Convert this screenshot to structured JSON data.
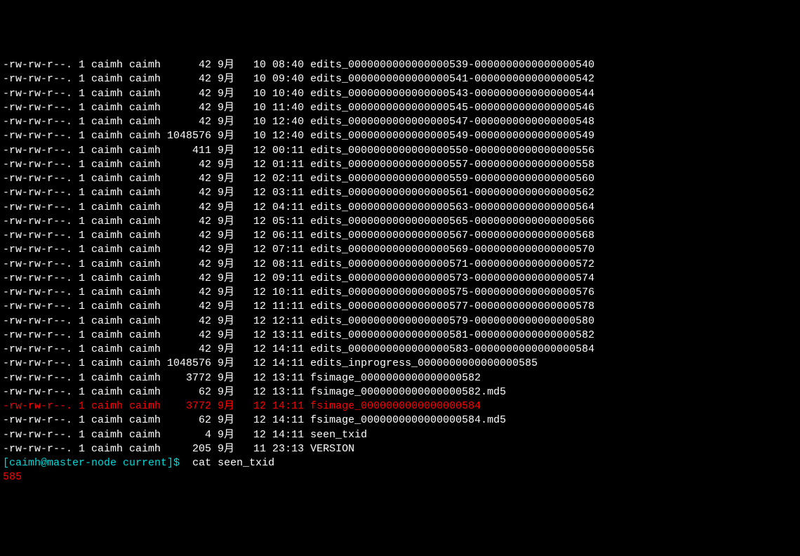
{
  "terminal": {
    "listing": [
      {
        "perms": "-rw-rw-r--.",
        "links": "1",
        "owner": "caimh",
        "group": "caimh",
        "size": "42",
        "month": "9月",
        "day": "10",
        "time": "08:40",
        "name": "edits_0000000000000000539-0000000000000000540",
        "highlight": false
      },
      {
        "perms": "-rw-rw-r--.",
        "links": "1",
        "owner": "caimh",
        "group": "caimh",
        "size": "42",
        "month": "9月",
        "day": "10",
        "time": "09:40",
        "name": "edits_0000000000000000541-0000000000000000542",
        "highlight": false
      },
      {
        "perms": "-rw-rw-r--.",
        "links": "1",
        "owner": "caimh",
        "group": "caimh",
        "size": "42",
        "month": "9月",
        "day": "10",
        "time": "10:40",
        "name": "edits_0000000000000000543-0000000000000000544",
        "highlight": false
      },
      {
        "perms": "-rw-rw-r--.",
        "links": "1",
        "owner": "caimh",
        "group": "caimh",
        "size": "42",
        "month": "9月",
        "day": "10",
        "time": "11:40",
        "name": "edits_0000000000000000545-0000000000000000546",
        "highlight": false
      },
      {
        "perms": "-rw-rw-r--.",
        "links": "1",
        "owner": "caimh",
        "group": "caimh",
        "size": "42",
        "month": "9月",
        "day": "10",
        "time": "12:40",
        "name": "edits_0000000000000000547-0000000000000000548",
        "highlight": false
      },
      {
        "perms": "-rw-rw-r--.",
        "links": "1",
        "owner": "caimh",
        "group": "caimh",
        "size": "1048576",
        "month": "9月",
        "day": "10",
        "time": "12:40",
        "name": "edits_0000000000000000549-0000000000000000549",
        "highlight": false
      },
      {
        "perms": "-rw-rw-r--.",
        "links": "1",
        "owner": "caimh",
        "group": "caimh",
        "size": "411",
        "month": "9月",
        "day": "12",
        "time": "00:11",
        "name": "edits_0000000000000000550-0000000000000000556",
        "highlight": false
      },
      {
        "perms": "-rw-rw-r--.",
        "links": "1",
        "owner": "caimh",
        "group": "caimh",
        "size": "42",
        "month": "9月",
        "day": "12",
        "time": "01:11",
        "name": "edits_0000000000000000557-0000000000000000558",
        "highlight": false
      },
      {
        "perms": "-rw-rw-r--.",
        "links": "1",
        "owner": "caimh",
        "group": "caimh",
        "size": "42",
        "month": "9月",
        "day": "12",
        "time": "02:11",
        "name": "edits_0000000000000000559-0000000000000000560",
        "highlight": false
      },
      {
        "perms": "-rw-rw-r--.",
        "links": "1",
        "owner": "caimh",
        "group": "caimh",
        "size": "42",
        "month": "9月",
        "day": "12",
        "time": "03:11",
        "name": "edits_0000000000000000561-0000000000000000562",
        "highlight": false
      },
      {
        "perms": "-rw-rw-r--.",
        "links": "1",
        "owner": "caimh",
        "group": "caimh",
        "size": "42",
        "month": "9月",
        "day": "12",
        "time": "04:11",
        "name": "edits_0000000000000000563-0000000000000000564",
        "highlight": false
      },
      {
        "perms": "-rw-rw-r--.",
        "links": "1",
        "owner": "caimh",
        "group": "caimh",
        "size": "42",
        "month": "9月",
        "day": "12",
        "time": "05:11",
        "name": "edits_0000000000000000565-0000000000000000566",
        "highlight": false
      },
      {
        "perms": "-rw-rw-r--.",
        "links": "1",
        "owner": "caimh",
        "group": "caimh",
        "size": "42",
        "month": "9月",
        "day": "12",
        "time": "06:11",
        "name": "edits_0000000000000000567-0000000000000000568",
        "highlight": false
      },
      {
        "perms": "-rw-rw-r--.",
        "links": "1",
        "owner": "caimh",
        "group": "caimh",
        "size": "42",
        "month": "9月",
        "day": "12",
        "time": "07:11",
        "name": "edits_0000000000000000569-0000000000000000570",
        "highlight": false
      },
      {
        "perms": "-rw-rw-r--.",
        "links": "1",
        "owner": "caimh",
        "group": "caimh",
        "size": "42",
        "month": "9月",
        "day": "12",
        "time": "08:11",
        "name": "edits_0000000000000000571-0000000000000000572",
        "highlight": false
      },
      {
        "perms": "-rw-rw-r--.",
        "links": "1",
        "owner": "caimh",
        "group": "caimh",
        "size": "42",
        "month": "9月",
        "day": "12",
        "time": "09:11",
        "name": "edits_0000000000000000573-0000000000000000574",
        "highlight": false
      },
      {
        "perms": "-rw-rw-r--.",
        "links": "1",
        "owner": "caimh",
        "group": "caimh",
        "size": "42",
        "month": "9月",
        "day": "12",
        "time": "10:11",
        "name": "edits_0000000000000000575-0000000000000000576",
        "highlight": false
      },
      {
        "perms": "-rw-rw-r--.",
        "links": "1",
        "owner": "caimh",
        "group": "caimh",
        "size": "42",
        "month": "9月",
        "day": "12",
        "time": "11:11",
        "name": "edits_0000000000000000577-0000000000000000578",
        "highlight": false
      },
      {
        "perms": "-rw-rw-r--.",
        "links": "1",
        "owner": "caimh",
        "group": "caimh",
        "size": "42",
        "month": "9月",
        "day": "12",
        "time": "12:11",
        "name": "edits_0000000000000000579-0000000000000000580",
        "highlight": false
      },
      {
        "perms": "-rw-rw-r--.",
        "links": "1",
        "owner": "caimh",
        "group": "caimh",
        "size": "42",
        "month": "9月",
        "day": "12",
        "time": "13:11",
        "name": "edits_0000000000000000581-0000000000000000582",
        "highlight": false
      },
      {
        "perms": "-rw-rw-r--.",
        "links": "1",
        "owner": "caimh",
        "group": "caimh",
        "size": "42",
        "month": "9月",
        "day": "12",
        "time": "14:11",
        "name": "edits_0000000000000000583-0000000000000000584",
        "highlight": false
      },
      {
        "perms": "-rw-rw-r--.",
        "links": "1",
        "owner": "caimh",
        "group": "caimh",
        "size": "1048576",
        "month": "9月",
        "day": "12",
        "time": "14:11",
        "name": "edits_inprogress_0000000000000000585",
        "highlight": false
      },
      {
        "perms": "-rw-rw-r--.",
        "links": "1",
        "owner": "caimh",
        "group": "caimh",
        "size": "3772",
        "month": "9月",
        "day": "12",
        "time": "13:11",
        "name": "fsimage_0000000000000000582",
        "highlight": false
      },
      {
        "perms": "-rw-rw-r--.",
        "links": "1",
        "owner": "caimh",
        "group": "caimh",
        "size": "62",
        "month": "9月",
        "day": "12",
        "time": "13:11",
        "name": "fsimage_0000000000000000582.md5",
        "highlight": false
      },
      {
        "perms": "-rw-rw-r--.",
        "links": "1",
        "owner": "caimh",
        "group": "caimh",
        "size": "3772",
        "month": "9月",
        "day": "12",
        "time": "14:11",
        "name": "fsimage_0000000000000000584",
        "highlight": true
      },
      {
        "perms": "-rw-rw-r--.",
        "links": "1",
        "owner": "caimh",
        "group": "caimh",
        "size": "62",
        "month": "9月",
        "day": "12",
        "time": "14:11",
        "name": "fsimage_0000000000000000584.md5",
        "highlight": false
      },
      {
        "perms": "-rw-rw-r--.",
        "links": "1",
        "owner": "caimh",
        "group": "caimh",
        "size": "4",
        "month": "9月",
        "day": "12",
        "time": "14:11",
        "name": "seen_txid",
        "highlight": false
      },
      {
        "perms": "-rw-rw-r--.",
        "links": "1",
        "owner": "caimh",
        "group": "caimh",
        "size": "205",
        "month": "9月",
        "day": "11",
        "time": "23:13",
        "name": "VERSION",
        "highlight": false
      }
    ],
    "prompt": {
      "user_host": "[caimh@master-node current]$",
      "command": "cat seen_txid"
    },
    "output": "585"
  }
}
